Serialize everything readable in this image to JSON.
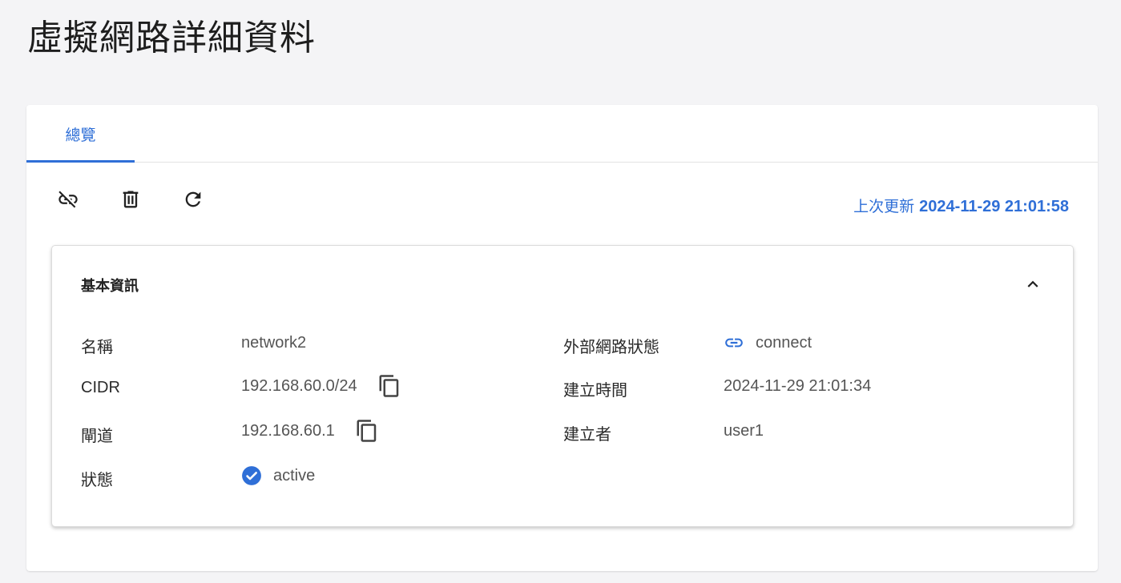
{
  "page": {
    "title": "虛擬網路詳細資料"
  },
  "tabs": [
    {
      "label": "總覽",
      "active": true
    }
  ],
  "toolbar": {
    "buttons": [
      {
        "name": "disconnect",
        "icon": "link-off-icon"
      },
      {
        "name": "delete",
        "icon": "trash-icon"
      },
      {
        "name": "refresh",
        "icon": "refresh-icon"
      }
    ],
    "last_update_label": "上次更新",
    "last_update_value": "2024-11-29 21:01:58"
  },
  "basic_info": {
    "title": "基本資訊",
    "name_label": "名稱",
    "name_value": "network2",
    "cidr_label": "CIDR",
    "cidr_value": "192.168.60.0/24",
    "gateway_label": "閘道",
    "gateway_value": "192.168.60.1",
    "status_label": "狀態",
    "status_value": "active",
    "ext_label": "外部網路狀態",
    "ext_value": "connect",
    "created_label": "建立時間",
    "created_value": "2024-11-29 21:01:34",
    "creator_label": "建立者",
    "creator_value": "user1"
  },
  "colors": {
    "accent": "#2f6fd7",
    "background": "#f4f4f6"
  }
}
